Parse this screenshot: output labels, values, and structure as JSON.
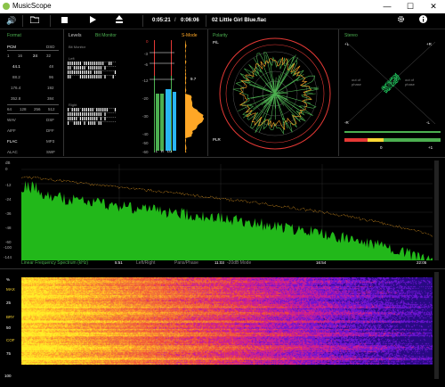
{
  "window": {
    "title": "MusicScope",
    "min": "—",
    "max": "☐",
    "close": "✕"
  },
  "toolbar": {
    "time_elapsed": "0:05:21",
    "time_sep": "/",
    "time_total": "0:06:06",
    "track": "02 Little Girl Blue.flac"
  },
  "format": {
    "title": "Format",
    "pcm": "PCM",
    "dsd": "DSD",
    "bits": [
      "1",
      "16",
      "24",
      "32"
    ],
    "rates": [
      [
        "44.1",
        "48"
      ],
      [
        "88.2",
        "96"
      ],
      [
        "176.4",
        "192"
      ],
      [
        "352.8",
        "384"
      ]
    ],
    "dsd_rates": [
      "64",
      "128",
      "256",
      "512"
    ],
    "formats": [
      [
        "WAV",
        "DSF"
      ],
      [
        "AIFF",
        "DFF"
      ],
      [
        "FLAC",
        "MP3"
      ],
      [
        "ALAC",
        "SWF"
      ]
    ]
  },
  "levels": {
    "title": "Levels",
    "mode": "Bit Monitor",
    "label": "Bit Monitor",
    "left": "Left",
    "right": "Right",
    "meter_mode": "S-Mode",
    "peak_value": "9.7",
    "scale": [
      "0",
      "-3",
      "-6",
      "-12",
      "-20",
      "-30",
      "-40",
      "-50",
      "-60"
    ],
    "channels": [
      "L",
      "R",
      "LU"
    ]
  },
  "polarity": {
    "title": "Polarity",
    "pl": "P/L",
    "plr": "PLR"
  },
  "stereo": {
    "title": "Stereo",
    "l": "+L",
    "r": "+R",
    "nl": "-L",
    "nr": "-R",
    "out_left": "out of phase",
    "out_right": "out of phase",
    "zero": "0",
    "plus_one": "+1"
  },
  "spectrum": {
    "db_label": "dB",
    "y_ticks": [
      "0",
      "-12",
      "-24",
      "-36",
      "-48",
      "-60",
      "-100",
      "-144"
    ],
    "x_ticks": [
      "5:51",
      "11:03",
      "16:54",
      "22:05"
    ],
    "legend": [
      "Linear Frequency Spectrum (kHz)",
      "Left/Right",
      "Pans/Phase",
      "-20dB Mode"
    ],
    "colors": {
      "fill": "#22b81a",
      "peak": "#f9a825"
    }
  },
  "spectrogram": {
    "y_ticks": [
      "%",
      "MAX",
      "25",
      "BRY",
      "50",
      "COF",
      "75",
      "100"
    ]
  }
}
